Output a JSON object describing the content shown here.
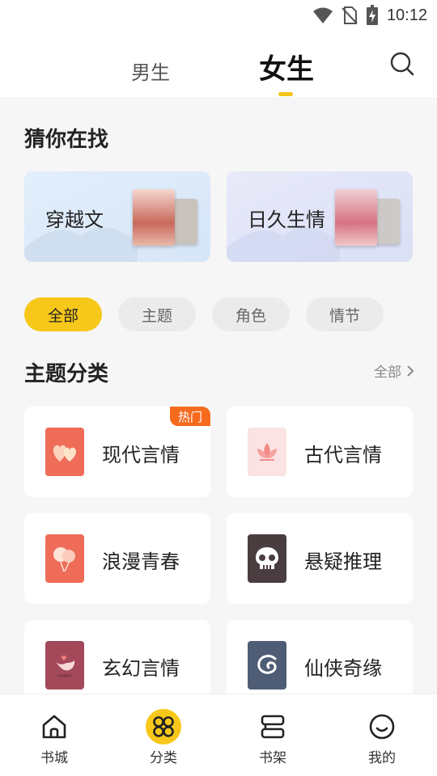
{
  "status_bar": {
    "time": "10:12"
  },
  "header": {
    "tabs": [
      {
        "label": "男生"
      },
      {
        "label": "女生"
      }
    ],
    "active_tab": "女生"
  },
  "guess": {
    "title": "猜你在找",
    "cards": [
      {
        "label": "穿越文"
      },
      {
        "label": "日久生情"
      }
    ]
  },
  "filters": [
    {
      "label": "全部",
      "active": true
    },
    {
      "label": "主题"
    },
    {
      "label": "角色"
    },
    {
      "label": "情节"
    }
  ],
  "theme": {
    "title": "主题分类",
    "all_label": "全部",
    "categories": [
      {
        "label": "现代言情",
        "badge": "热门",
        "icon": "hearts-icon",
        "color": "#ee6c58"
      },
      {
        "label": "古代言情",
        "icon": "lotus-icon",
        "color": "#fbe3e3"
      },
      {
        "label": "浪漫青春",
        "icon": "balloons-icon",
        "color": "#ee6c58"
      },
      {
        "label": "悬疑推理",
        "icon": "skull-icon",
        "color": "#4a3d3f"
      },
      {
        "label": "玄幻言情",
        "icon": "bird-icon",
        "color": "#a4495a"
      },
      {
        "label": "仙侠奇缘",
        "icon": "swirl-icon",
        "color": "#4f5c75"
      }
    ]
  },
  "bottom_nav": [
    {
      "label": "书城",
      "icon": "home-icon"
    },
    {
      "label": "分类",
      "icon": "category-icon",
      "active": true
    },
    {
      "label": "书架",
      "icon": "bookshelf-icon"
    },
    {
      "label": "我的",
      "icon": "smile-icon"
    }
  ],
  "colors": {
    "accent": "#f7c81a",
    "hot": "#f56a1d"
  }
}
